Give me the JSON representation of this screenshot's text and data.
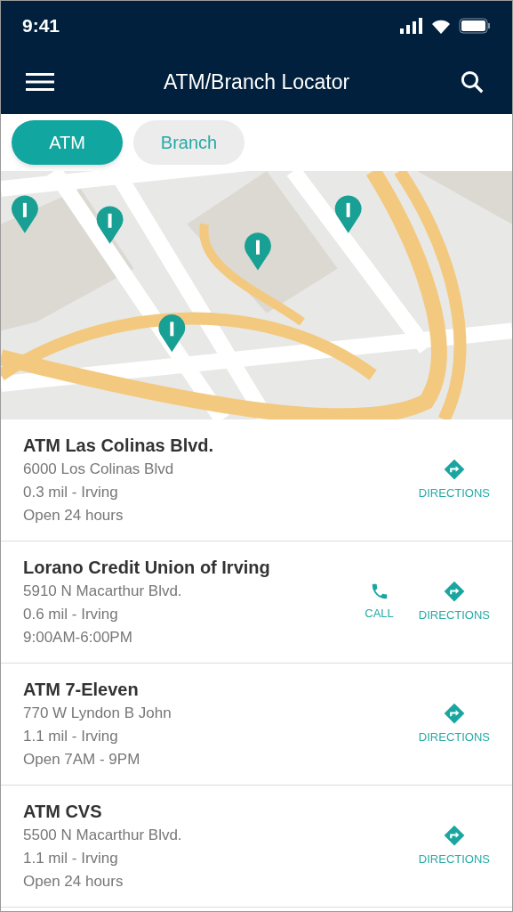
{
  "status_bar": {
    "time": "9:41"
  },
  "header": {
    "title": "ATM/Branch Locator"
  },
  "tabs": [
    {
      "label": "ATM",
      "selected": true
    },
    {
      "label": "Branch",
      "selected": false
    }
  ],
  "locations": [
    {
      "name": "ATM Las Colinas Blvd.",
      "address": "6000 Los Colinas Blvd",
      "distance": "0.3 mil - Irving",
      "hours": "Open 24 hours",
      "actions": [
        {
          "kind": "directions",
          "label": "DIRECTIONS"
        }
      ]
    },
    {
      "name": "Lorano Credit Union of Irving",
      "address": "5910 N Macarthur Blvd.",
      "distance": "0.6 mil - Irving",
      "hours": "9:00AM-6:00PM",
      "actions": [
        {
          "kind": "call",
          "label": "CALL"
        },
        {
          "kind": "directions",
          "label": "DIRECTIONS"
        }
      ]
    },
    {
      "name": "ATM 7-Eleven",
      "address": "770 W Lyndon B John",
      "distance": "1.1 mil - Irving",
      "hours": "Open 7AM - 9PM",
      "actions": [
        {
          "kind": "directions",
          "label": "DIRECTIONS"
        }
      ]
    },
    {
      "name": "ATM CVS",
      "address": "5500 N Macarthur Blvd.",
      "distance": "1.1 mil - Irving",
      "hours": "Open 24 hours",
      "actions": [
        {
          "kind": "directions",
          "label": "DIRECTIONS"
        }
      ]
    }
  ]
}
